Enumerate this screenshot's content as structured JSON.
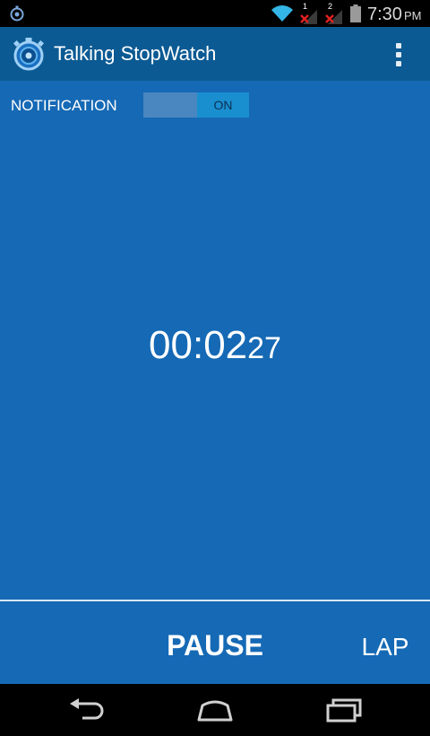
{
  "status_bar": {
    "time": "7:30",
    "ampm": "PM",
    "sim1": "1",
    "sim2": "2",
    "icons": [
      "stopwatch-notification-icon",
      "wifi-icon",
      "signal-no-service-icon",
      "battery-icon"
    ]
  },
  "app_bar": {
    "title": "Talking StopWatch",
    "icons": [
      "stopwatch-app-icon",
      "overflow-menu-icon"
    ]
  },
  "notification": {
    "label": "NOTIFICATION",
    "toggle_state": "ON"
  },
  "timer": {
    "main": "00:02",
    "fraction": "27"
  },
  "controls": {
    "pause_label": "PAUSE",
    "lap_label": "LAP"
  },
  "nav_bar": {
    "icons": [
      "back-icon",
      "home-icon",
      "recent-apps-icon"
    ]
  },
  "colors": {
    "main_bg": "#1569b5",
    "app_bar_bg": "#0b5a93",
    "toggle_on": "#1a8fd0"
  }
}
